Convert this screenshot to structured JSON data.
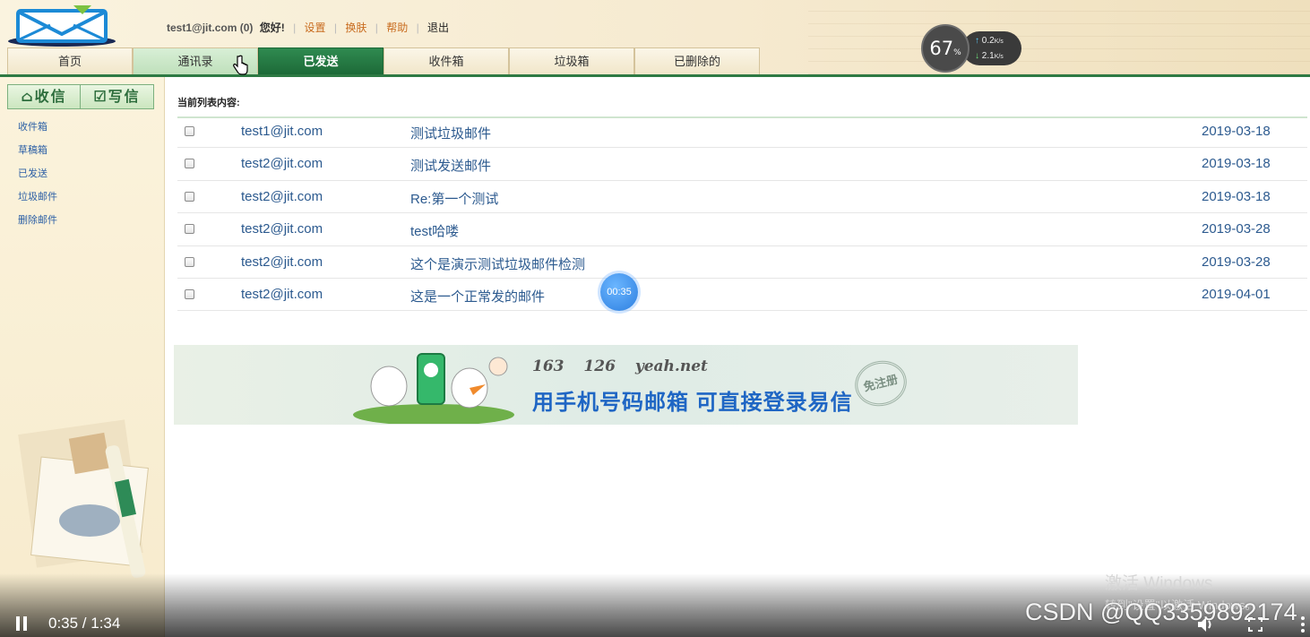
{
  "header": {
    "user_email": "test1@jit.com (0)",
    "greeting": "您好!",
    "links": [
      {
        "label": "设置"
      },
      {
        "label": "换肤"
      },
      {
        "label": "帮助"
      },
      {
        "label": "退出"
      }
    ]
  },
  "tabs": [
    {
      "label": "首页"
    },
    {
      "label": "通讯录",
      "state": "hover"
    },
    {
      "label": "已发送",
      "state": "active"
    },
    {
      "label": "收件箱"
    },
    {
      "label": "垃圾箱"
    },
    {
      "label": "已删除的"
    }
  ],
  "speed_widget": {
    "percent": "67",
    "percent_unit": "%",
    "upload": "0.2",
    "download": "2.1",
    "unit": "K/s"
  },
  "sidebar": {
    "receive_button": "收信",
    "write_button": "写信",
    "items": [
      {
        "label": "收件箱"
      },
      {
        "label": "草稿箱"
      },
      {
        "label": "已发送"
      },
      {
        "label": "垃圾邮件"
      },
      {
        "label": "删除邮件"
      }
    ]
  },
  "main": {
    "list_title": "当前列表内容:",
    "rows": [
      {
        "from": "test1@jit.com",
        "subject": "测试垃圾邮件",
        "date": "2019-03-18"
      },
      {
        "from": "test2@jit.com",
        "subject": "测试发送邮件",
        "date": "2019-03-18"
      },
      {
        "from": "test2@jit.com",
        "subject": "Re:第一个测试",
        "date": "2019-03-18"
      },
      {
        "from": "test2@jit.com",
        "subject": "test哈喽",
        "date": "2019-03-28"
      },
      {
        "from": "test2@jit.com",
        "subject": "这个是演示测试垃圾邮件检测",
        "date": "2019-03-28"
      },
      {
        "from": "test2@jit.com",
        "subject": "这是一个正常发的邮件",
        "date": "2019-04-01"
      }
    ],
    "time_bubble": "00:35"
  },
  "banner": {
    "brands": [
      "163",
      "126",
      "yeah.net"
    ],
    "slogan": "用手机号码邮箱  可直接登录易信",
    "badge": "免注册"
  },
  "video": {
    "time": "0:35 / 1:34",
    "activate_line1": "激活 Windows",
    "activate_line2": "转到\"设置\"以激活 Windows。",
    "watermark": "CSDN @QQ3359892174"
  },
  "colors": {
    "tab_active": "#1d6a38",
    "link_orange": "#c86b1e",
    "mail_text": "#2c5a8f",
    "sidebar_link": "#2b5fa5"
  }
}
